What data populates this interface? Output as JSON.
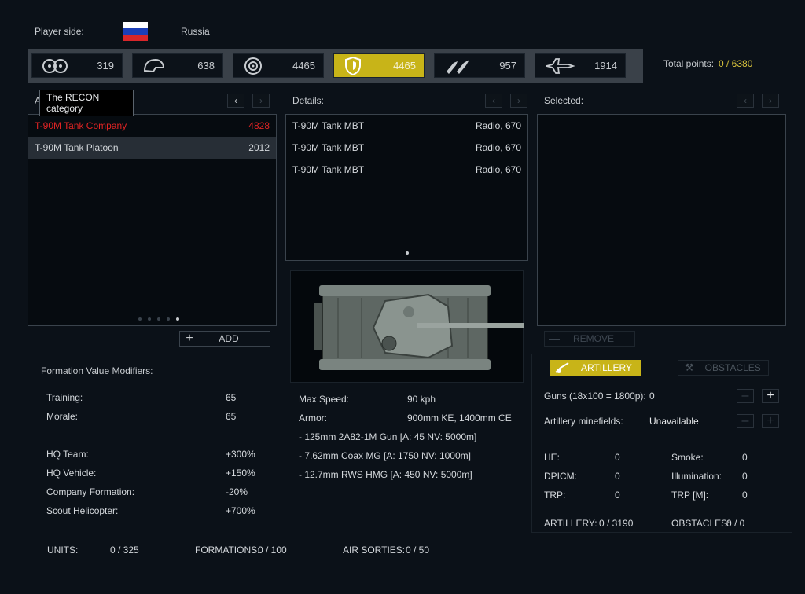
{
  "player": {
    "side_label": "Player side:",
    "country": "Russia"
  },
  "categories": [
    {
      "icon": "recon-icon",
      "count": "319"
    },
    {
      "icon": "infantry-helmet-icon",
      "count": "638"
    },
    {
      "icon": "wheeled-vehicle-icon",
      "count": "4465"
    },
    {
      "icon": "armor-shield-icon",
      "count": "4465",
      "active": true
    },
    {
      "icon": "artillery-ammo-icon",
      "count": "957"
    },
    {
      "icon": "aircraft-icon",
      "count": "1914"
    }
  ],
  "total": {
    "label": "Total points:",
    "value": "0 / 6380"
  },
  "tooltip": "The RECON category",
  "available": {
    "label": "A",
    "items": [
      {
        "name": "T-90M Tank Company",
        "points": "4828"
      },
      {
        "name": "T-90M Tank Platoon",
        "points": "2012"
      }
    ],
    "add_label": "ADD"
  },
  "details": {
    "label": "Details:",
    "items": [
      {
        "name": "T-90M Tank MBT",
        "info": "Radio, 670"
      },
      {
        "name": "T-90M Tank MBT",
        "info": "Radio, 670"
      },
      {
        "name": "T-90M Tank MBT",
        "info": "Radio, 670"
      }
    ]
  },
  "selected": {
    "label": "Selected:",
    "remove_label": "REMOVE"
  },
  "modifiers": {
    "title": "Formation Value Modifiers:",
    "training_label": "Training:",
    "training": "65",
    "morale_label": "Morale:",
    "morale": "65",
    "hq_team_label": "HQ Team:",
    "hq_team": "+300%",
    "hq_vehicle_label": "HQ Vehicle:",
    "hq_vehicle": "+150%",
    "company_label": "Company Formation:",
    "company": "-20%",
    "scout_label": "Scout Helicopter:",
    "scout": "+700%"
  },
  "stats": {
    "speed_label": "Max Speed:",
    "speed": "90 kph",
    "armor_label": "Armor:",
    "armor": "900mm KE, 1400mm CE",
    "weapons": [
      "- 125mm 2A82-1M Gun [A: 45 NV: 5000m]",
      "- 7.62mm Coax MG [A: 1750 NV: 1000m]",
      "- 12.7mm RWS HMG [A: 450 NV: 5000m]"
    ]
  },
  "support": {
    "artillery_tab": "ARTILLERY",
    "obstacles_tab": "OBSTACLES",
    "guns_label": "Guns (18x100 = 1800p):",
    "guns": "0",
    "minefields_label": "Artillery minefields:",
    "minefields": "Unavailable",
    "he_label": "HE:",
    "he": "0",
    "dpicm_label": "DPICM:",
    "dpicm": "0",
    "trp_label": "TRP:",
    "trp": "0",
    "smoke_label": "Smoke:",
    "smoke": "0",
    "illum_label": "Illumination:",
    "illum": "0",
    "trpm_label": "TRP [M]:",
    "trpm": "0",
    "artillery_total_label": "ARTILLERY:",
    "artillery_total": "0 / 3190",
    "obstacles_total_label": "OBSTACLES:",
    "obstacles_total": "0 / 0"
  },
  "footer": {
    "units_label": "UNITS:",
    "units": "0 / 325",
    "formations_label": "FORMATIONS:",
    "formations": "0 / 100",
    "air_label": "AIR SORTIES:",
    "air": "0 / 50"
  },
  "colors": {
    "accent": "#c8b418",
    "warning": "#e02424",
    "background": "#0b1118"
  }
}
